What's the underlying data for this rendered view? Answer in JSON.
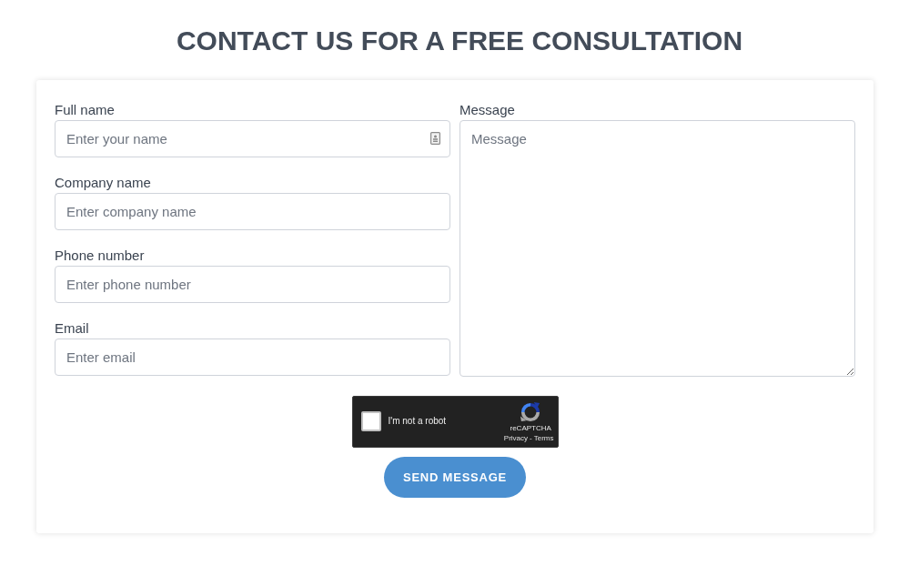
{
  "title": "CONTACT US FOR A FREE CONSULTATION",
  "fields": [
    {
      "label": "Full name",
      "placeholder": "Enter your name",
      "autofill_icon": true
    },
    {
      "label": "Company name",
      "placeholder": "Enter company name",
      "autofill_icon": false
    },
    {
      "label": "Phone number",
      "placeholder": "Enter phone number",
      "autofill_icon": false
    },
    {
      "label": "Email",
      "placeholder": "Enter email",
      "autofill_icon": false
    }
  ],
  "message": {
    "label": "Message",
    "placeholder": "Message"
  },
  "captcha": {
    "checked": false,
    "label": "I'm not a robot",
    "brand": "reCAPTCHA",
    "links": [
      "Privacy",
      "Terms"
    ],
    "separator": "-"
  },
  "submit": {
    "label": "SEND MESSAGE"
  }
}
